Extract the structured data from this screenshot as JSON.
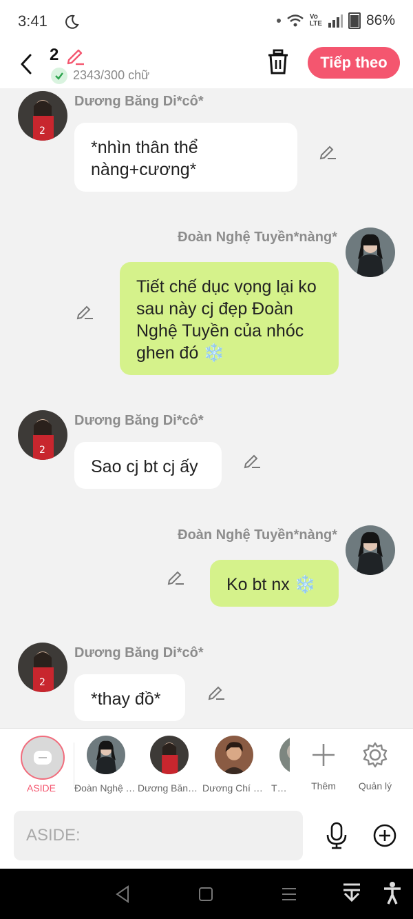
{
  "status": {
    "time": "3:41",
    "battery": "86%"
  },
  "header": {
    "count": "2",
    "word_count": "2343/300 chữ",
    "next_label": "Tiếp theo"
  },
  "messages": [
    {
      "side": "left",
      "author": "Dương Băng Di*cô*",
      "text": "*nhìn thân thể nàng+cương*"
    },
    {
      "side": "right",
      "author": "Đoàn Nghệ Tuyền*nàng*",
      "text": "Tiết chế dục vọng lại ko sau này cj đẹp Đoàn Nghệ Tuyền của nhóc ghen đó ❄️"
    },
    {
      "side": "left",
      "author": "Dương Băng Di*cô*",
      "text": "Sao cj bt cj ấy"
    },
    {
      "side": "right",
      "author": "Đoàn Nghệ Tuyền*nàng*",
      "text": "Ko bt nx ❄️"
    },
    {
      "side": "left",
      "author": "Dương Băng Di*cô*",
      "text": "*thay đồ*"
    }
  ],
  "characters": {
    "aside_label": "ASIDE",
    "items": [
      {
        "label": "Đoàn Nghệ Tuyền"
      },
      {
        "label": "Dương Băng Di"
      },
      {
        "label": "Dương Chí Hải"
      },
      {
        "label": "Tả T"
      }
    ],
    "add_label": "Thêm",
    "manage_label": "Quản lý"
  },
  "input": {
    "placeholder": "ASIDE:"
  },
  "colors": {
    "accent": "#f4566f",
    "bubble_right": "#d5f28b",
    "bubble_left": "#ffffff"
  }
}
